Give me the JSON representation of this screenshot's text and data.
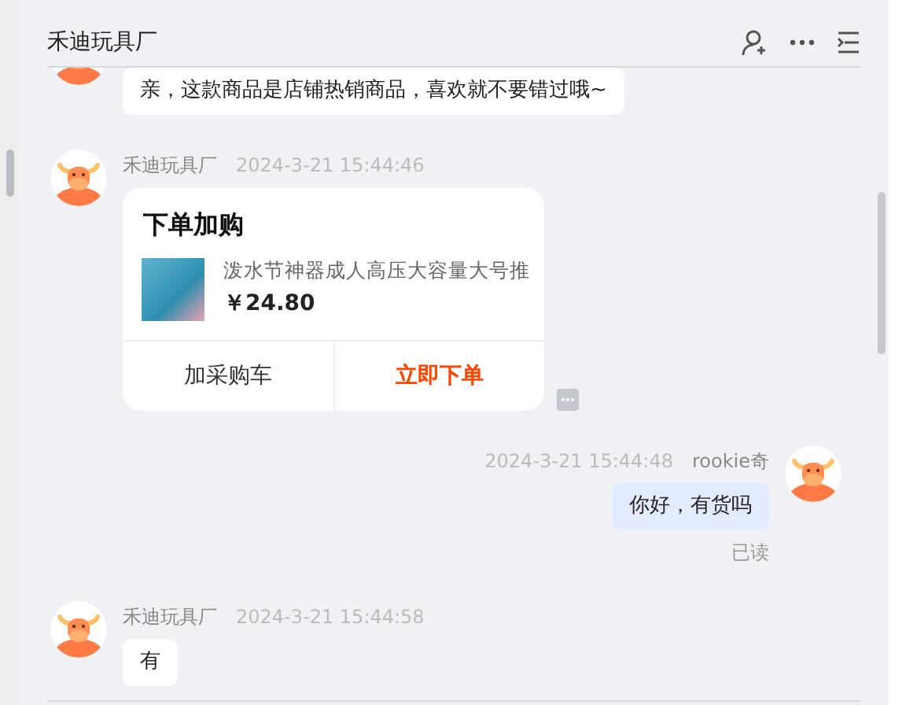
{
  "header": {
    "title": "禾迪玩具厂"
  },
  "messages": [
    {
      "kind": "text",
      "mine": false,
      "text": "亲，这款商品是店铺热销商品，喜欢就不要错过哦~"
    },
    {
      "kind": "product_card",
      "mine": false,
      "sender": "禾迪玩具厂",
      "time": "2024-3-21 15:44:46",
      "card": {
        "title": "下单加购",
        "product_name": "泼水节神器成人高压大容量大号推",
        "price": "￥24.80",
        "actions": [
          {
            "label": "加采购车",
            "primary": false
          },
          {
            "label": "立即下单",
            "primary": true
          }
        ]
      }
    },
    {
      "kind": "text",
      "mine": true,
      "sender": "rookie奇",
      "time": "2024-3-21 15:44:48",
      "text": "你好，有货吗",
      "receipt": "已读"
    },
    {
      "kind": "text",
      "mine": false,
      "sender": "禾迪玩具厂",
      "time": "2024-3-21 15:44:58",
      "text": "有"
    }
  ]
}
